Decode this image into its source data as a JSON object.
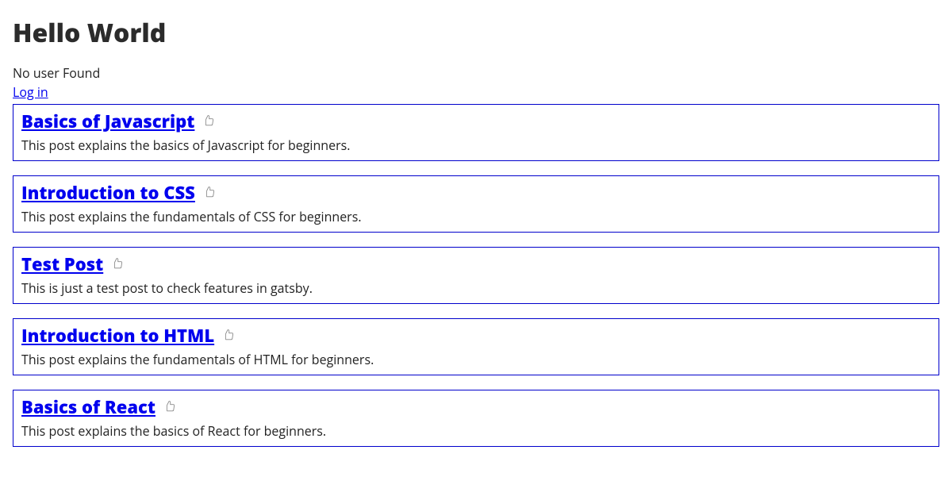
{
  "header": {
    "title": "Hello World",
    "no_user_text": "No user Found",
    "login_label": "Log in"
  },
  "posts": [
    {
      "title": "Basics of Javascript",
      "description": "This post explains the basics of Javascript for beginners."
    },
    {
      "title": "Introduction to CSS",
      "description": "This post explains the fundamentals of CSS for beginners."
    },
    {
      "title": "Test Post",
      "description": "This is just a test post to check features in gatsby."
    },
    {
      "title": "Introduction to HTML",
      "description": "This post explains the fundamentals of HTML for beginners."
    },
    {
      "title": "Basics of React",
      "description": "This post explains the basics of React for beginners."
    }
  ]
}
